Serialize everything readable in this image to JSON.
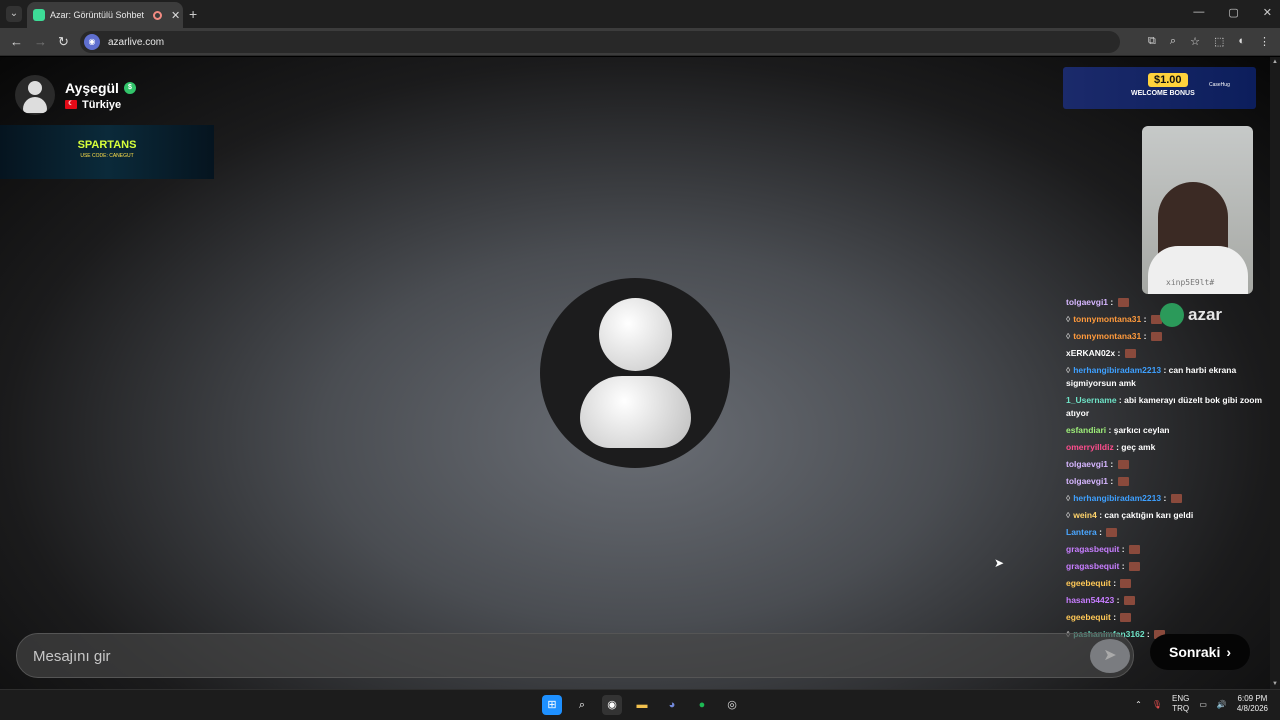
{
  "browser": {
    "tab_title": "Azar: Görüntülü Sohbet & Y",
    "url": "azarlive.com"
  },
  "profile": {
    "name": "Ayşegül",
    "country": "Türkiye"
  },
  "banner": {
    "title": "SPARTANS",
    "subtitle": "USE CODE: CANEGUT"
  },
  "ad": {
    "price": "$1.00",
    "label": "WELCOME BONUS",
    "brand": "CaseHug"
  },
  "webcam": {
    "watermark": "xinp5E9lt#"
  },
  "logo": {
    "text": "azar"
  },
  "chat": [
    {
      "user": "tolgaevgi1",
      "sep": " : ",
      "text": "",
      "color": "#d6b6ff",
      "sub": false,
      "emote": true
    },
    {
      "user": "tonnymontana31",
      "sep": " : ",
      "text": "",
      "color": "#ff9a3c",
      "sub": true,
      "emote": true
    },
    {
      "user": "tonnymontana31",
      "sep": " : ",
      "text": "",
      "color": "#ff9a3c",
      "sub": true,
      "emote": true
    },
    {
      "user": "xERKAN02x",
      "sep": " : ",
      "text": "",
      "color": "#ffffff",
      "sub": false,
      "emote": true
    },
    {
      "user": "herhangibiradam2213",
      "sep": " : ",
      "text": "can harbi ekrana sigmiyorsun amk",
      "color": "#3ea0ff",
      "sub": true,
      "emote": false
    },
    {
      "user": "1_Username",
      "sep": " : ",
      "text": "abi kamerayı düzelt bok gibi zoom atıyor",
      "color": "#6fe3c7",
      "sub": false,
      "emote": false
    },
    {
      "user": "esfandiari",
      "sep": " : ",
      "text": "şarkıcı ceylan",
      "color": "#9ff07a",
      "sub": false,
      "emote": false
    },
    {
      "user": "omerryilldiz",
      "sep": " : ",
      "text": "geç amk",
      "color": "#ff4d8d",
      "sub": false,
      "emote": false
    },
    {
      "user": "tolgaevgi1",
      "sep": " : ",
      "text": "",
      "color": "#d6b6ff",
      "sub": false,
      "emote": true
    },
    {
      "user": "tolgaevgi1",
      "sep": " : ",
      "text": "",
      "color": "#d6b6ff",
      "sub": false,
      "emote": true
    },
    {
      "user": "herhangibiradam2213",
      "sep": " : ",
      "text": "",
      "color": "#3ea0ff",
      "sub": true,
      "emote": true
    },
    {
      "user": "wein4",
      "sep": " : ",
      "text": "can çaktığın karı geldi",
      "color": "#ffd36b",
      "sub": true,
      "emote": false
    },
    {
      "user": "Lantera",
      "sep": " : ",
      "text": "",
      "color": "#4aa6ff",
      "sub": false,
      "emote": true
    },
    {
      "user": "gragasbequit",
      "sep": " : ",
      "text": "",
      "color": "#c77dff",
      "sub": false,
      "emote": true
    },
    {
      "user": "gragasbequit",
      "sep": " : ",
      "text": "",
      "color": "#c77dff",
      "sub": false,
      "emote": true
    },
    {
      "user": "egeebequit",
      "sep": " : ",
      "text": "",
      "color": "#ffc857",
      "sub": false,
      "emote": true
    },
    {
      "user": "hasan54423",
      "sep": " : ",
      "text": "",
      "color": "#c77dff",
      "sub": false,
      "emote": true
    },
    {
      "user": "egeebequit",
      "sep": " : ",
      "text": "",
      "color": "#ffc857",
      "sub": false,
      "emote": true
    },
    {
      "user": "pashanimfan3162",
      "sep": " : ",
      "text": "",
      "color": "#6fe3c7",
      "sub": true,
      "emote": true
    }
  ],
  "input": {
    "placeholder": "Mesajını gir"
  },
  "next_button": {
    "label": "Sonraki"
  },
  "taskbar": {
    "lang_top": "ENG",
    "lang_bottom": "TRQ",
    "time": "6:09 PM",
    "date": "4/8/2026"
  }
}
